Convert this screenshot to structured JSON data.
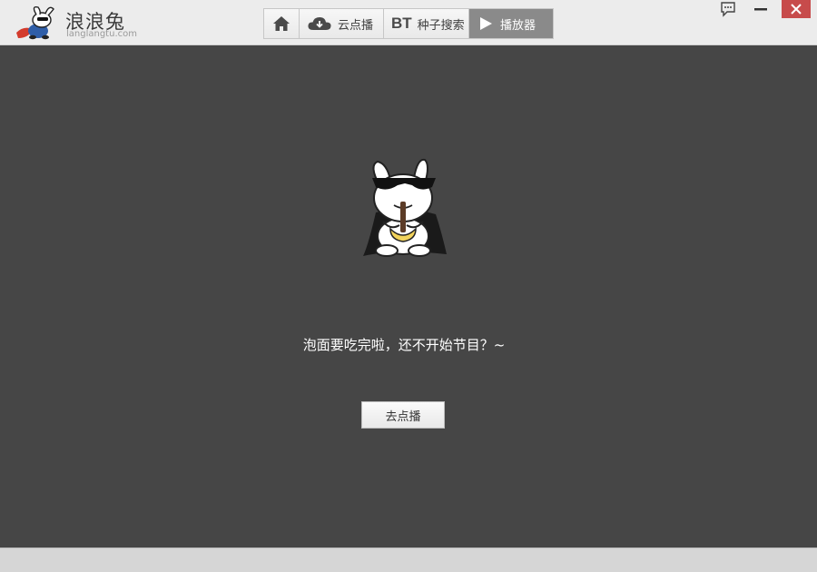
{
  "app": {
    "name": "浪浪兔",
    "url": "langlangtu.com"
  },
  "nav": {
    "tabs": [
      {
        "id": "home",
        "label": "",
        "icon": "home-icon"
      },
      {
        "id": "cloud",
        "label": "云点播",
        "icon": "cloud-icon"
      },
      {
        "id": "bt",
        "label": "种子搜索",
        "icon": "bt-icon",
        "glyph": "BT"
      },
      {
        "id": "player",
        "label": "播放器",
        "icon": "play-icon",
        "active": true
      }
    ]
  },
  "window_controls": [
    "feedback-icon",
    "minimize-icon",
    "close-icon"
  ],
  "main": {
    "message": "泡面要吃完啦，还不开始节目？~",
    "button_label": "去点播"
  },
  "colors": {
    "background": "#464646",
    "titlebar": "#ececec",
    "active_tab": "#8a8a8a",
    "close_button": "#c74b4b",
    "statusbar": "#d6d6d6"
  }
}
